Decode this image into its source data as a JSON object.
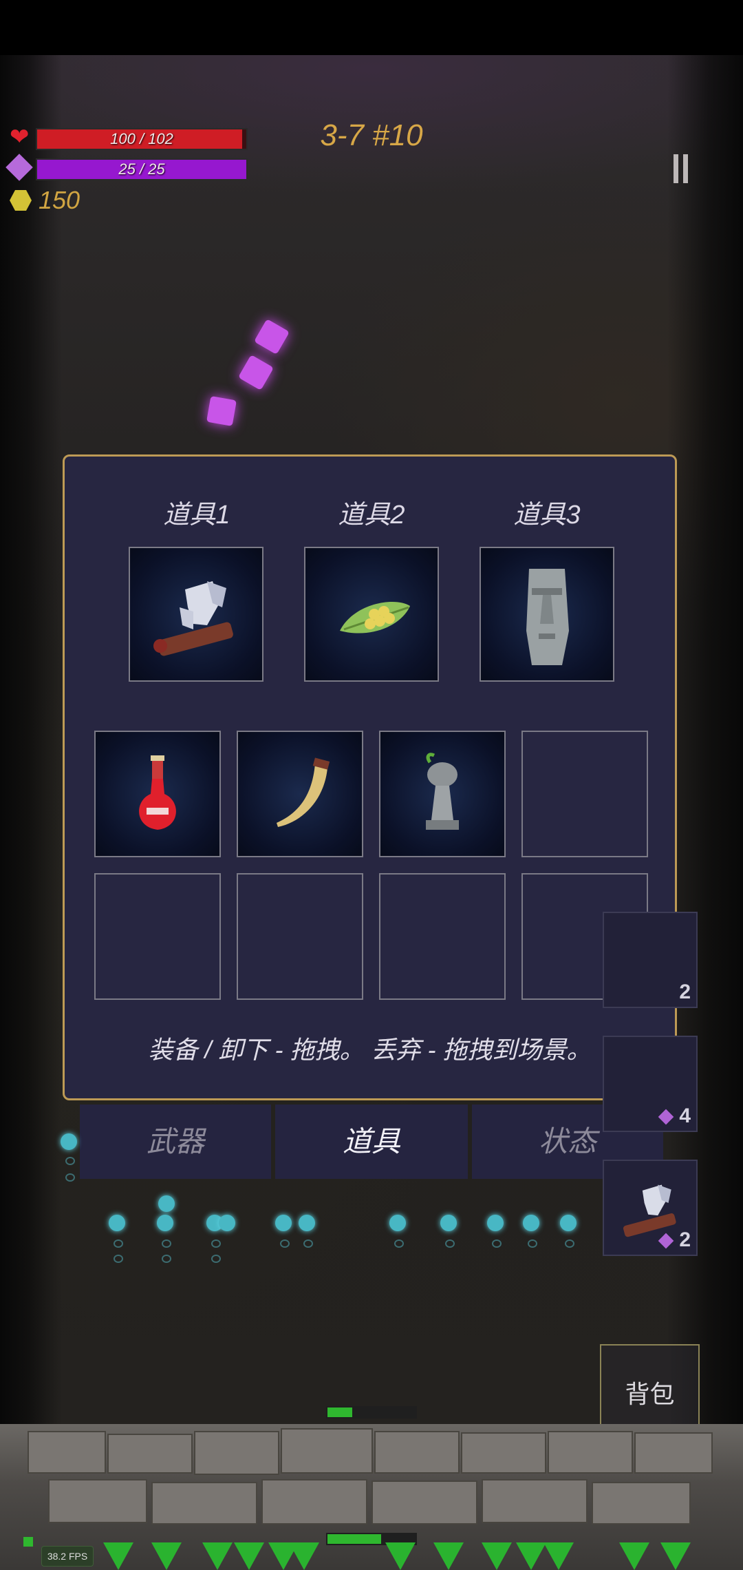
{
  "hud": {
    "hp": {
      "current": 100,
      "max": 102,
      "text": "100 / 102",
      "fill": 0.98
    },
    "mp": {
      "current": 25,
      "max": 25,
      "text": "25 / 25",
      "fill": 1.0
    },
    "gold": "150",
    "stage": "3-7 #10",
    "icons": {
      "hp": "heart-icon",
      "mp": "mana-gem-icon",
      "gold": "coin-icon",
      "pause": "pause-icon"
    }
  },
  "inventory": {
    "slot_labels": [
      "道具1",
      "道具2",
      "道具3"
    ],
    "equipped": [
      {
        "icon": "flag-scroll-icon"
      },
      {
        "icon": "herb-leaf-icon"
      },
      {
        "icon": "moai-statue-icon"
      }
    ],
    "bag": [
      {
        "icon": "red-potion-icon"
      },
      {
        "icon": "horn-icon"
      },
      {
        "icon": "chess-pawn-icon"
      },
      {
        "icon": ""
      },
      {
        "icon": ""
      },
      {
        "icon": ""
      },
      {
        "icon": ""
      },
      {
        "icon": ""
      }
    ],
    "hint": "装备 / 卸下 - 拖拽。    丢弃 - 拖拽到场景。"
  },
  "tabs": [
    {
      "label": "武器",
      "active": false
    },
    {
      "label": "道具",
      "active": true
    },
    {
      "label": "状态",
      "active": false
    }
  ],
  "side_cards": [
    {
      "count": "2"
    },
    {
      "count": "4"
    },
    {
      "count": "2"
    }
  ],
  "bag_button": "背包",
  "fps": "38.2 FPS",
  "colors": {
    "accent": "#bd9a55",
    "panel": "#272641",
    "hp": "#cf1d25",
    "mp": "#9618cf",
    "gold": "#d1a542"
  }
}
